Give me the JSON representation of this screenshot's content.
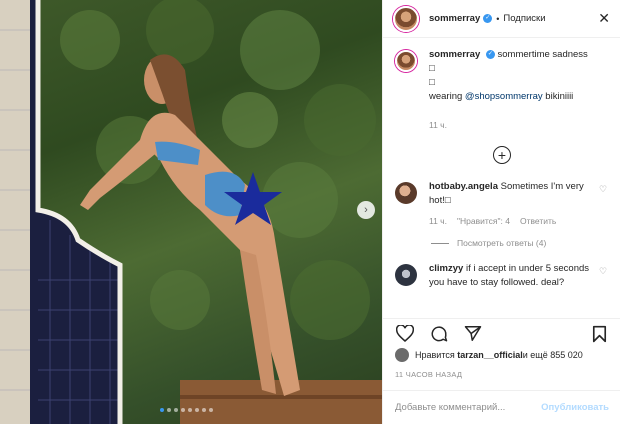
{
  "post": {
    "username": "sommerray",
    "verified_mark": "✓",
    "separator": "•",
    "follow_label": "Подписки",
    "close_glyph": "✕"
  },
  "caption": {
    "username": "sommerray",
    "text_line1": "sommertime sadness □",
    "text_line2": "□",
    "text_line3_prefix": "wearing ",
    "mention": "@shopsommerray",
    "text_line3_suffix": " bikiniiii",
    "time": "11 ч."
  },
  "load_more_glyph": "+",
  "comments": [
    {
      "username": "hotbaby.angela",
      "text": "Sometimes I'm very hot!□",
      "time": "11 ч.",
      "likes_label": "\"Нравится\": 4",
      "reply_label": "Ответить",
      "view_replies": "Посмотреть ответы (4)"
    },
    {
      "username": "climzyy",
      "text": "if i accept in under 5 seconds you have to stay followed. deal?"
    }
  ],
  "likes": {
    "prefix": "Нравится ",
    "user": "tarzan__official",
    "suffix": " и ещё 855 020"
  },
  "post_time": "11 ЧАСОВ НАЗАД",
  "add_comment": {
    "placeholder": "Добавьте комментарий...",
    "publish_label": "Опубликовать"
  },
  "nav_next_glyph": "›",
  "colors": {
    "accent": "#3897f0",
    "publish_disabled": "#b3dbff",
    "muted": "#8e8e8e",
    "text": "#262626"
  },
  "icons": [
    "heart-icon",
    "comment-icon",
    "share-icon",
    "bookmark-icon",
    "close-icon",
    "plus-circle-icon",
    "chevron-right-icon"
  ]
}
